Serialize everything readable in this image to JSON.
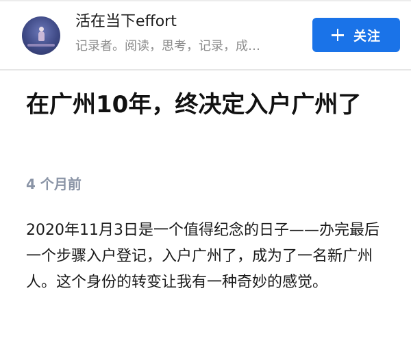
{
  "author": {
    "name": "活在当下effort",
    "bio": "记录者。阅读，思考，记录，成…",
    "avatar_icon": "avatar-night-figure"
  },
  "follow_button": {
    "icon": "plus-icon",
    "label": "关注",
    "color": "#1a73e8"
  },
  "article": {
    "title": "在广州10年，终决定入户广州了",
    "time": "4 个月前",
    "body": "2020年11月3日是一个值得纪念的日子——办完最后一个步骤入户登记，入户广州了，成为了一名新广州人。这个身份的转变让我有一种奇妙的感觉。"
  }
}
